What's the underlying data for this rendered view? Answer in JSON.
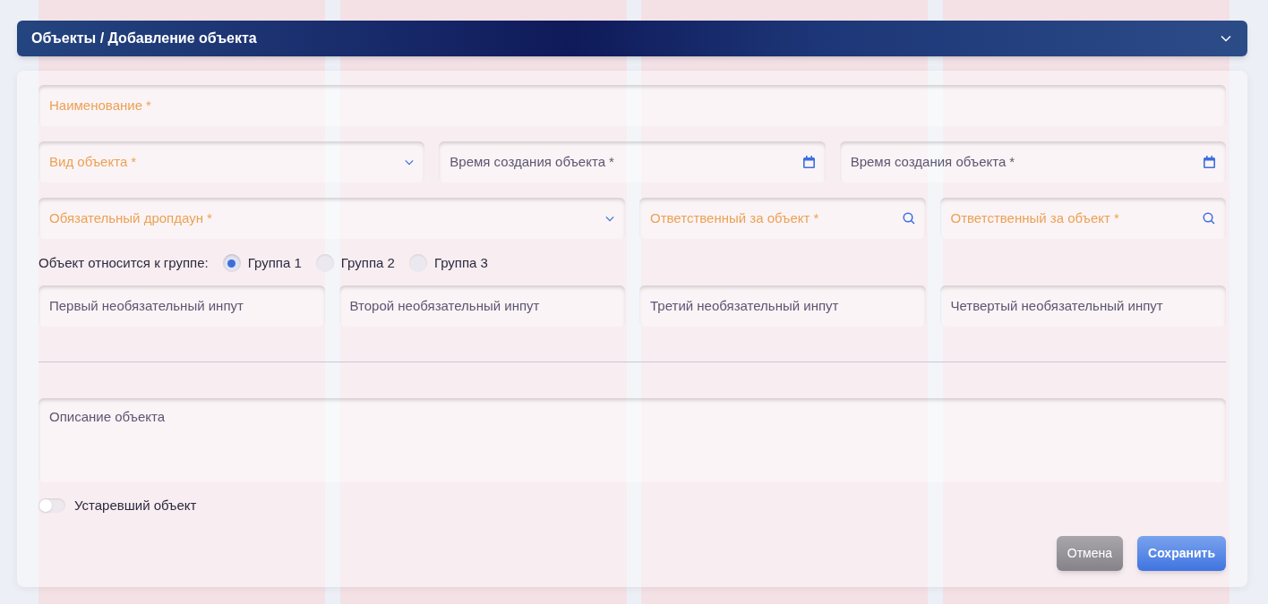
{
  "header": {
    "title": "Объекты / Добавление объекта"
  },
  "field_rows": [
    [
      {
        "kind": "text",
        "label": "Наименование",
        "required_mark": "*",
        "error": true
      }
    ],
    [
      {
        "kind": "select",
        "label": "Вид объекта",
        "required_mark": "*",
        "error": true
      },
      {
        "kind": "date",
        "label": "Время создания объекта",
        "required_mark": "*",
        "error": false
      },
      {
        "kind": "date",
        "label": "Время создания объекта",
        "required_mark": "*",
        "error": false
      }
    ],
    [
      {
        "kind": "select",
        "label": "Обязательный дропдаун",
        "required_mark": "*",
        "error": true
      },
      {
        "kind": "search",
        "label": "Ответственный за объект",
        "required_mark": "*",
        "error": true
      },
      {
        "kind": "search",
        "label": "Ответственный за объект",
        "required_mark": "*",
        "error": true
      }
    ]
  ],
  "group": {
    "label": "Объект относится к группе:",
    "options": [
      {
        "label": "Группа 1",
        "selected": true
      },
      {
        "label": "Группа 2",
        "selected": false
      },
      {
        "label": "Группа 3",
        "selected": false
      }
    ]
  },
  "optional_inputs": [
    {
      "label": "Первый необязательный инпут",
      "error": false
    },
    {
      "label": "Второй необязательный инпут",
      "error": false
    },
    {
      "label": "Третий необязательный инпут",
      "error": false
    },
    {
      "label": "Четвертый необязательный инпут",
      "error": false
    }
  ],
  "description": {
    "placeholder": "Описание объекта"
  },
  "obsolete": {
    "label": "Устаревший объект",
    "on": false
  },
  "buttons": [
    {
      "kind": "secondary",
      "label": "Отмена"
    },
    {
      "kind": "primary",
      "label": "Сохранить"
    }
  ]
}
